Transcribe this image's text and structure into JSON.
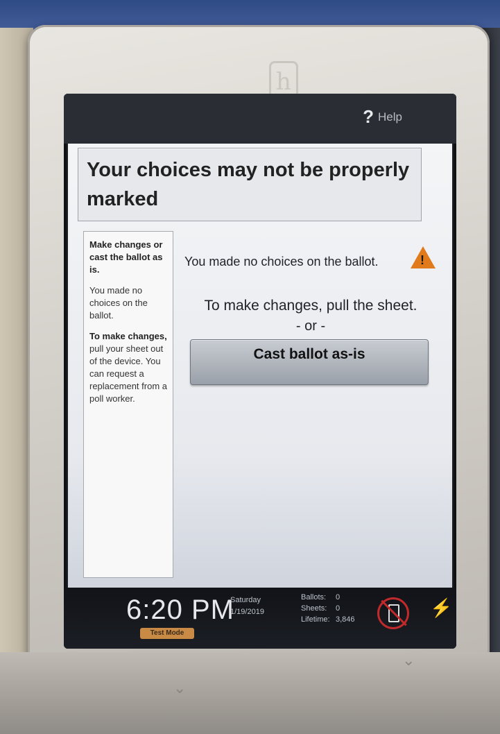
{
  "help": {
    "icon": "question-icon",
    "label": "Help"
  },
  "title": "Your choices may not be properly marked",
  "sidebar": {
    "heading": "Make changes or cast the ballot as is.",
    "paragraph1": "You made no choices on the ballot.",
    "paragraph2_bold": "To make changes,",
    "paragraph2_rest": " pull your sheet out of the device. You can request a replacement from a poll worker."
  },
  "main": {
    "warning_text": "You made no choices on the ballot.",
    "warning_icon": "warning-triangle-icon",
    "changes_text": "To make changes, pull the sheet.",
    "or_text": "- or -",
    "cast_button": "Cast ballot as-is"
  },
  "status": {
    "time": "6:20 PM",
    "mode": "Test Mode",
    "day": "Saturday",
    "date": "1/19/2019",
    "ballots_label": "Ballots:",
    "ballots_value": "0",
    "sheets_label": "Sheets:",
    "sheets_value": "0",
    "lifetime_label": "Lifetime:",
    "lifetime_value": "3,846",
    "battery_icon": "no-battery-icon",
    "power_icon": "plug-icon"
  },
  "colors": {
    "warning": "#e07a1a",
    "test_mode": "#c98a45",
    "battery_alert": "#c12a2a",
    "power": "#4cb84c"
  }
}
